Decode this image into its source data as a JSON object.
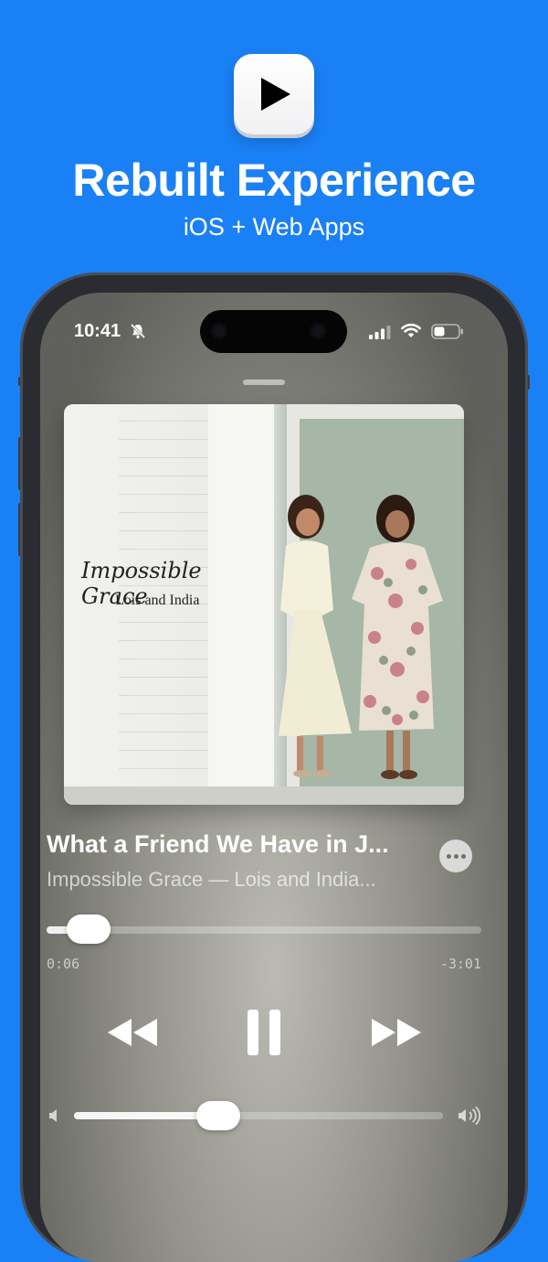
{
  "marketing": {
    "headline": "Rebuilt Experience",
    "subheadline": "iOS + Web Apps",
    "app_icon": "play-icon"
  },
  "status_bar": {
    "time": "10:41",
    "icons": [
      "bell-slash-icon",
      "cellular-signal-icon",
      "wifi-icon",
      "battery-icon"
    ]
  },
  "artwork": {
    "title_text": "Impossible Grace",
    "subtitle_text": "Lois and India"
  },
  "now_playing": {
    "title": "What a Friend We Have in J...",
    "artist": "Impossible Grace — Lois and India...",
    "elapsed": "0:06",
    "remaining": "-3:01",
    "progress_fraction": 0.032,
    "volume_fraction": 0.39
  },
  "controls": [
    "rewind-icon",
    "pause-icon",
    "fast-forward-icon",
    "more-icon",
    "volume-low-icon",
    "volume-high-icon"
  ],
  "colors": {
    "background": "#1a80f5",
    "text": "#ffffff"
  }
}
